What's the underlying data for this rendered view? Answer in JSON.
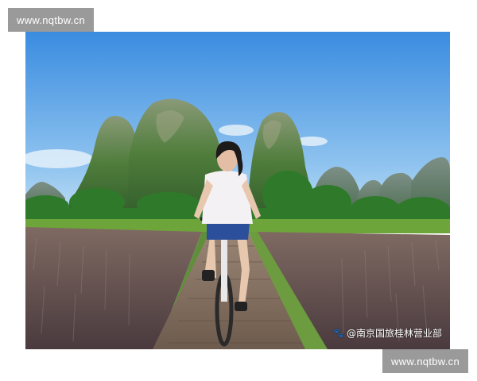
{
  "watermark": {
    "text": "www.nqtbw.cn"
  },
  "photo": {
    "credit": "@南京国旅桂林营业部",
    "credit_icon": "paw-icon"
  },
  "colors": {
    "sky_top": "#3d8fe0",
    "sky_bottom": "#a9d2f2",
    "mountain": "#4f7a3a",
    "field": "#6f5a5c",
    "boardwalk": "#8a7462",
    "shirt": "#f4f1f4",
    "watermark_bg": "#9a9a9a"
  }
}
